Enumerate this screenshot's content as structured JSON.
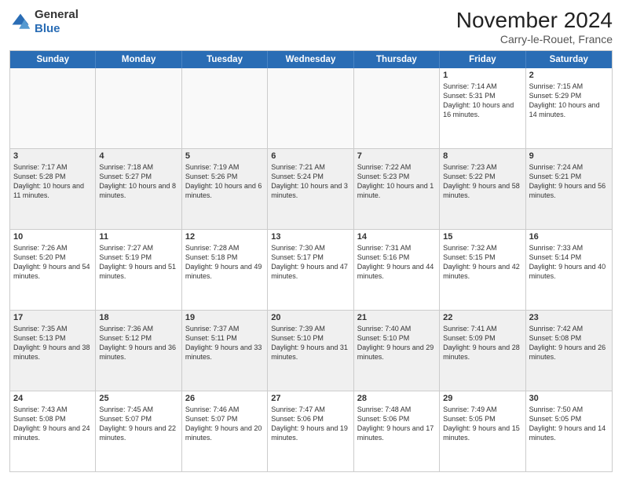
{
  "logo": {
    "line1": "General",
    "line2": "Blue",
    "icon_title": "GeneralBlue logo"
  },
  "header": {
    "month": "November 2024",
    "location": "Carry-le-Rouet, France"
  },
  "days_of_week": [
    "Sunday",
    "Monday",
    "Tuesday",
    "Wednesday",
    "Thursday",
    "Friday",
    "Saturday"
  ],
  "weeks": [
    [
      {
        "day": "",
        "info": ""
      },
      {
        "day": "",
        "info": ""
      },
      {
        "day": "",
        "info": ""
      },
      {
        "day": "",
        "info": ""
      },
      {
        "day": "",
        "info": ""
      },
      {
        "day": "1",
        "info": "Sunrise: 7:14 AM\nSunset: 5:31 PM\nDaylight: 10 hours and 16 minutes."
      },
      {
        "day": "2",
        "info": "Sunrise: 7:15 AM\nSunset: 5:29 PM\nDaylight: 10 hours and 14 minutes."
      }
    ],
    [
      {
        "day": "3",
        "info": "Sunrise: 7:17 AM\nSunset: 5:28 PM\nDaylight: 10 hours and 11 minutes."
      },
      {
        "day": "4",
        "info": "Sunrise: 7:18 AM\nSunset: 5:27 PM\nDaylight: 10 hours and 8 minutes."
      },
      {
        "day": "5",
        "info": "Sunrise: 7:19 AM\nSunset: 5:26 PM\nDaylight: 10 hours and 6 minutes."
      },
      {
        "day": "6",
        "info": "Sunrise: 7:21 AM\nSunset: 5:24 PM\nDaylight: 10 hours and 3 minutes."
      },
      {
        "day": "7",
        "info": "Sunrise: 7:22 AM\nSunset: 5:23 PM\nDaylight: 10 hours and 1 minute."
      },
      {
        "day": "8",
        "info": "Sunrise: 7:23 AM\nSunset: 5:22 PM\nDaylight: 9 hours and 58 minutes."
      },
      {
        "day": "9",
        "info": "Sunrise: 7:24 AM\nSunset: 5:21 PM\nDaylight: 9 hours and 56 minutes."
      }
    ],
    [
      {
        "day": "10",
        "info": "Sunrise: 7:26 AM\nSunset: 5:20 PM\nDaylight: 9 hours and 54 minutes."
      },
      {
        "day": "11",
        "info": "Sunrise: 7:27 AM\nSunset: 5:19 PM\nDaylight: 9 hours and 51 minutes."
      },
      {
        "day": "12",
        "info": "Sunrise: 7:28 AM\nSunset: 5:18 PM\nDaylight: 9 hours and 49 minutes."
      },
      {
        "day": "13",
        "info": "Sunrise: 7:30 AM\nSunset: 5:17 PM\nDaylight: 9 hours and 47 minutes."
      },
      {
        "day": "14",
        "info": "Sunrise: 7:31 AM\nSunset: 5:16 PM\nDaylight: 9 hours and 44 minutes."
      },
      {
        "day": "15",
        "info": "Sunrise: 7:32 AM\nSunset: 5:15 PM\nDaylight: 9 hours and 42 minutes."
      },
      {
        "day": "16",
        "info": "Sunrise: 7:33 AM\nSunset: 5:14 PM\nDaylight: 9 hours and 40 minutes."
      }
    ],
    [
      {
        "day": "17",
        "info": "Sunrise: 7:35 AM\nSunset: 5:13 PM\nDaylight: 9 hours and 38 minutes."
      },
      {
        "day": "18",
        "info": "Sunrise: 7:36 AM\nSunset: 5:12 PM\nDaylight: 9 hours and 36 minutes."
      },
      {
        "day": "19",
        "info": "Sunrise: 7:37 AM\nSunset: 5:11 PM\nDaylight: 9 hours and 33 minutes."
      },
      {
        "day": "20",
        "info": "Sunrise: 7:39 AM\nSunset: 5:10 PM\nDaylight: 9 hours and 31 minutes."
      },
      {
        "day": "21",
        "info": "Sunrise: 7:40 AM\nSunset: 5:10 PM\nDaylight: 9 hours and 29 minutes."
      },
      {
        "day": "22",
        "info": "Sunrise: 7:41 AM\nSunset: 5:09 PM\nDaylight: 9 hours and 28 minutes."
      },
      {
        "day": "23",
        "info": "Sunrise: 7:42 AM\nSunset: 5:08 PM\nDaylight: 9 hours and 26 minutes."
      }
    ],
    [
      {
        "day": "24",
        "info": "Sunrise: 7:43 AM\nSunset: 5:08 PM\nDaylight: 9 hours and 24 minutes."
      },
      {
        "day": "25",
        "info": "Sunrise: 7:45 AM\nSunset: 5:07 PM\nDaylight: 9 hours and 22 minutes."
      },
      {
        "day": "26",
        "info": "Sunrise: 7:46 AM\nSunset: 5:07 PM\nDaylight: 9 hours and 20 minutes."
      },
      {
        "day": "27",
        "info": "Sunrise: 7:47 AM\nSunset: 5:06 PM\nDaylight: 9 hours and 19 minutes."
      },
      {
        "day": "28",
        "info": "Sunrise: 7:48 AM\nSunset: 5:06 PM\nDaylight: 9 hours and 17 minutes."
      },
      {
        "day": "29",
        "info": "Sunrise: 7:49 AM\nSunset: 5:05 PM\nDaylight: 9 hours and 15 minutes."
      },
      {
        "day": "30",
        "info": "Sunrise: 7:50 AM\nSunset: 5:05 PM\nDaylight: 9 hours and 14 minutes."
      }
    ]
  ]
}
